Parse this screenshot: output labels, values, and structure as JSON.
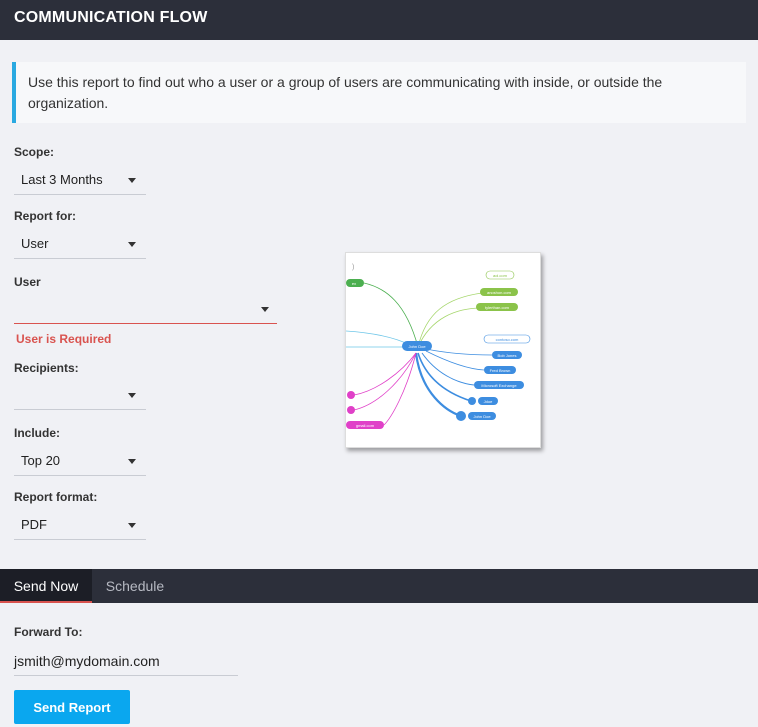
{
  "header": {
    "title": "COMMUNICATION FLOW"
  },
  "info": {
    "text": "Use this report to find out who a user or a group of users are communicating with inside, or outside the organization."
  },
  "form": {
    "scope": {
      "label": "Scope:",
      "value": "Last 3 Months"
    },
    "report_for": {
      "label": "Report for:",
      "value": "User"
    },
    "user": {
      "label": "User",
      "value": "",
      "error": "User is Required"
    },
    "recipients": {
      "label": "Recipients:",
      "value": ""
    },
    "include": {
      "label": "Include:",
      "value": "Top 20"
    },
    "report_format": {
      "label": "Report format:",
      "value": "PDF"
    }
  },
  "preview": {
    "center_node": "John Doe",
    "outside_domains": [
      "aol.com",
      "anoshon.com",
      "tylerthan.com"
    ],
    "inside_domain": "contoso.com",
    "inside_nodes": [
      "Bob Jones",
      "Fred Brown",
      "Microsoft Exchange",
      "Jdoe",
      "John Doe"
    ],
    "left_nodes": [
      "ex",
      "gmail.com"
    ],
    "colors": {
      "outside": "#8bc34a",
      "inside": "#3d8de0",
      "left_green": "#4caf50",
      "left_pink": "#e040c8"
    }
  },
  "tabs": {
    "send_now": "Send Now",
    "schedule": "Schedule",
    "active": "send_now"
  },
  "send": {
    "forward_label": "Forward To:",
    "forward_value": "jsmith@mydomain.com",
    "button_label": "Send Report"
  }
}
